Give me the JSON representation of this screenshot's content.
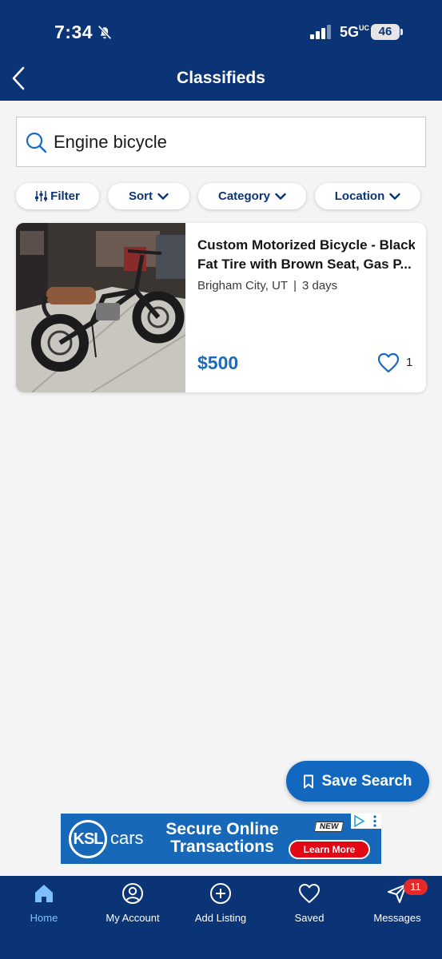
{
  "status_bar": {
    "time": "7:34",
    "network": "5G",
    "network_suffix": "UC",
    "battery": "46",
    "icons": [
      "bell-slash-icon",
      "signal-icon",
      "battery-icon"
    ]
  },
  "header": {
    "title": "Classifieds",
    "back_icon": "chevron-left-icon"
  },
  "search": {
    "value": "Engine bicycle",
    "icon": "search-icon"
  },
  "chips": [
    {
      "label": "Filter",
      "icon": "sliders-icon"
    },
    {
      "label": "Sort",
      "icon": "chevron-down-icon"
    },
    {
      "label": "Category",
      "icon": "chevron-down-icon"
    },
    {
      "label": "Location",
      "icon": "chevron-down-icon"
    }
  ],
  "listing": {
    "title_line1": "Custom Motorized Bicycle - Black",
    "title_line2": "Fat Tire with Brown Seat, Gas P...",
    "location": "Brigham City, UT",
    "separator": "|",
    "age": "3 days",
    "price": "$500",
    "favorites": "1",
    "photo": "motorized-bicycle-photo"
  },
  "save_search": {
    "label": "Save Search",
    "icon": "bookmark-icon"
  },
  "ad": {
    "logo": "KSL",
    "brand": "cars",
    "headline_line1": "Secure Online",
    "headline_line2": "Transactions",
    "tag": "NEW",
    "cta": "Learn More"
  },
  "bottom_nav": {
    "items": [
      {
        "label": "Home",
        "icon": "home-icon",
        "active": true
      },
      {
        "label": "My Account",
        "icon": "user-icon",
        "active": false
      },
      {
        "label": "Add Listing",
        "icon": "plus-circle-icon",
        "active": false
      },
      {
        "label": "Saved",
        "icon": "heart-icon",
        "active": false
      },
      {
        "label": "Messages",
        "icon": "send-icon",
        "active": false
      }
    ],
    "messages_badge": "11"
  },
  "colors": {
    "brand_navy": "#0b3477",
    "price_blue": "#1a6bbd",
    "button_blue": "#1268bf",
    "active_nav": "#7ec0ff",
    "badge_red": "#e22a2a"
  }
}
